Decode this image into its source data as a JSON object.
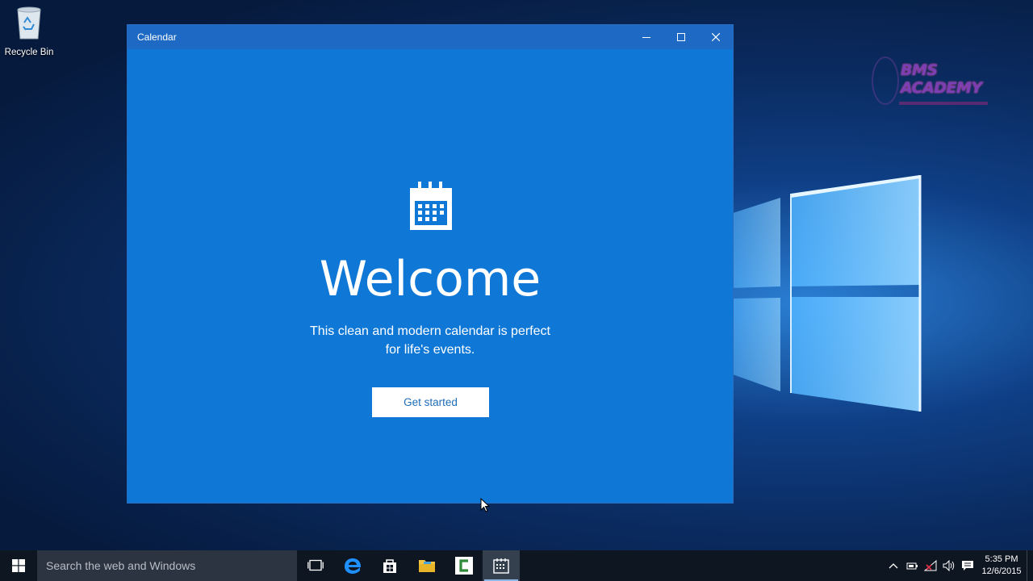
{
  "desktop": {
    "recycle_bin_label": "Recycle Bin",
    "watermark": "BMS ACADEMY"
  },
  "window": {
    "title": "Calendar",
    "controls": [
      "minimize-icon",
      "maximize-icon",
      "close-icon"
    ],
    "background": "#0f78d7"
  },
  "welcome": {
    "icon": "calendar-icon",
    "heading": "Welcome",
    "subtitle_line1": "This clean and modern calendar is perfect",
    "subtitle_line2": "for life's events.",
    "button_label": "Get started"
  },
  "taskbar": {
    "search_placeholder": "Search the web and Windows",
    "pinned": [
      {
        "name": "task-view-icon"
      },
      {
        "name": "edge-icon"
      },
      {
        "name": "store-icon"
      },
      {
        "name": "file-explorer-icon"
      },
      {
        "name": "camtasia-icon"
      },
      {
        "name": "calendar-app-icon",
        "active": true
      }
    ],
    "tray_icons": [
      "chevron-up-icon",
      "power-icon",
      "network-icon",
      "volume-icon",
      "action-center-icon"
    ],
    "time": "5:35 PM",
    "date": "12/6/2015"
  }
}
